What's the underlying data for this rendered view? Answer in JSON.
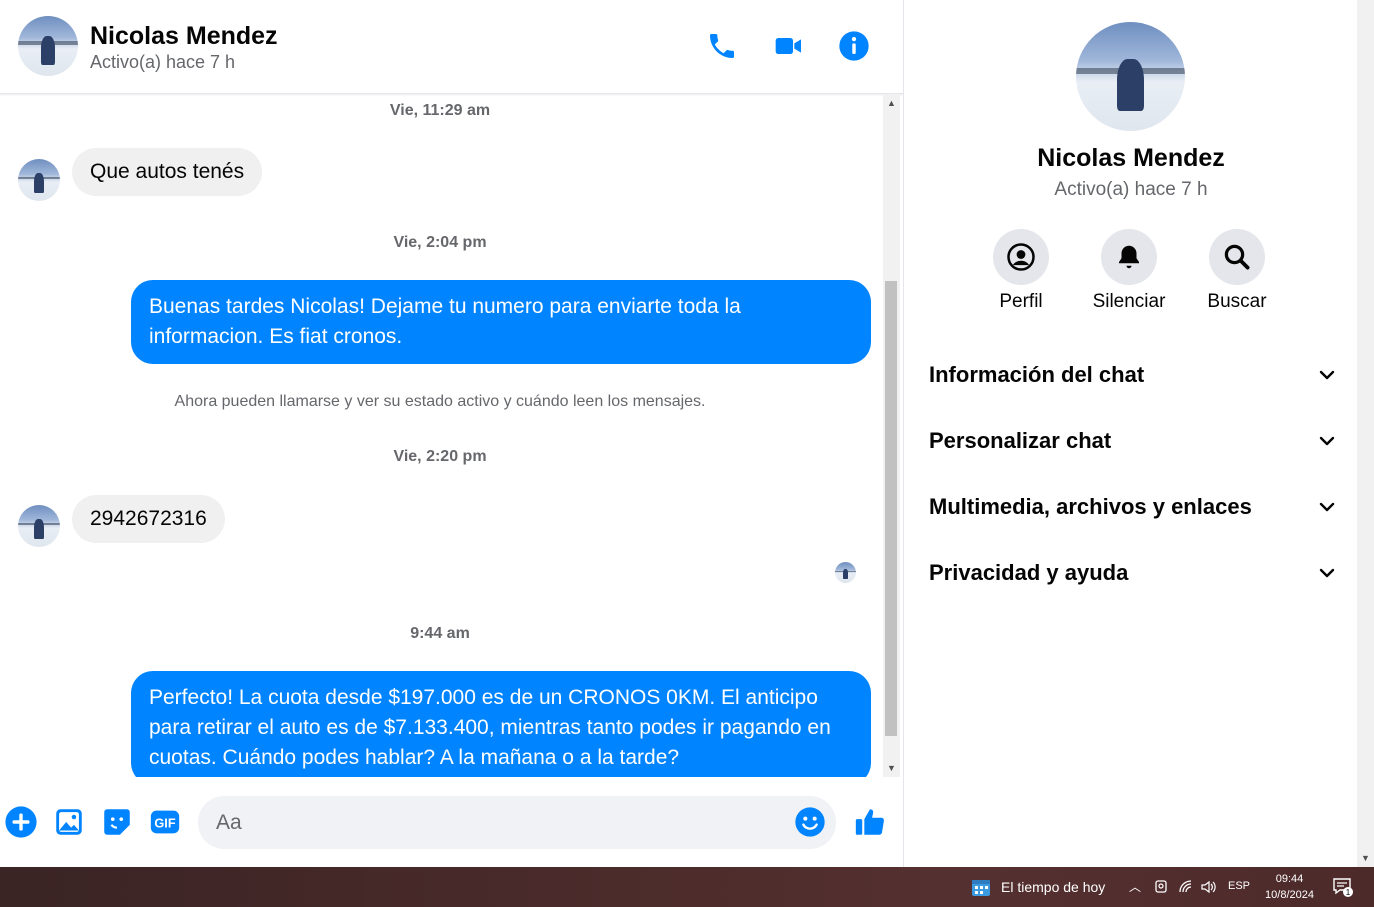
{
  "header": {
    "name": "Nicolas Mendez",
    "status": "Activo(a) hace 7 h"
  },
  "messages": {
    "ts1": "Vie, 11:29 am",
    "in1": "Que autos tenés",
    "ts2": "Vie, 2:04 pm",
    "out1": "Buenas tardes Nicolas! Dejame tu numero para enviarte toda la informacion. Es fiat cronos.",
    "system": "Ahora pueden llamarse y ver su estado activo y cuándo leen los mensajes.",
    "ts3": "Vie, 2:20 pm",
    "in2": "2942672316",
    "ts4": "9:44 am",
    "out2": "Perfecto! La cuota desde $197.000 es de un CRONOS 0KM. El anticipo para retirar el auto es de $7.133.400, mientras tanto podes ir pagando en cuotas. Cuándo podes hablar? A la mañana o a la tarde?"
  },
  "composer": {
    "placeholder": "Aa",
    "gif_label": "GIF"
  },
  "info": {
    "name": "Nicolas Mendez",
    "status": "Activo(a) hace 7 h",
    "actions": [
      {
        "label": "Perfil",
        "icon": "profile-icon"
      },
      {
        "label": "Silenciar",
        "icon": "bell-icon"
      },
      {
        "label": "Buscar",
        "icon": "search-icon"
      }
    ],
    "sections": [
      {
        "label": "Información del chat"
      },
      {
        "label": "Personalizar chat"
      },
      {
        "label": "Multimedia, archivos y enlaces"
      },
      {
        "label": "Privacidad y ayuda"
      }
    ]
  },
  "taskbar": {
    "weather": "El tiempo de hoy",
    "lang": "ESP",
    "time": "09:44",
    "date": "10/8/2024",
    "notif_count": "1"
  },
  "colors": {
    "accent": "#0084ff",
    "incoming_bubble": "#f0f0f0"
  }
}
